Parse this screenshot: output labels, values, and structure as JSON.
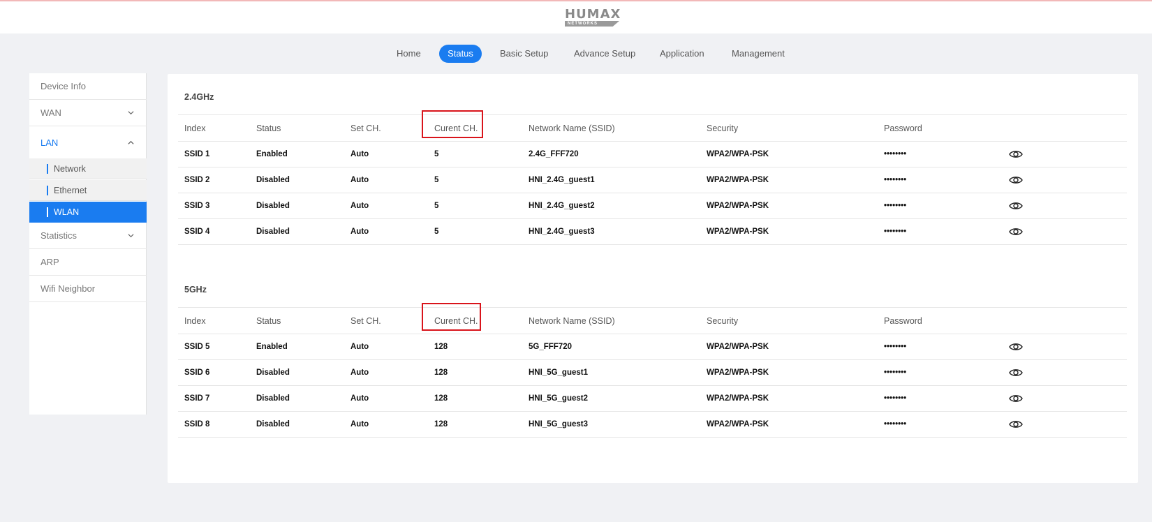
{
  "brand": {
    "logo_text": "HUMAX",
    "logo_sub": "NETWORKS"
  },
  "nav": {
    "items": [
      "Home",
      "Status",
      "Basic Setup",
      "Advance Setup",
      "Application",
      "Management"
    ],
    "active": "Status"
  },
  "sidebar": {
    "items": [
      {
        "label": "Device Info"
      },
      {
        "label": "WAN",
        "chevron": "chevron-down-icon"
      },
      {
        "label": "LAN",
        "chevron": "chevron-up-icon"
      },
      {
        "label": "Statistics",
        "chevron": "chevron-down-icon"
      },
      {
        "label": "ARP"
      },
      {
        "label": "Wifi Neighbor"
      }
    ],
    "lan_sub": [
      "Network",
      "Ethernet",
      "WLAN"
    ],
    "active_sub": "WLAN"
  },
  "columns": [
    "Index",
    "Status",
    "Set CH.",
    "Curent CH.",
    "Network Name (SSID)",
    "Security",
    "Password"
  ],
  "bands": [
    {
      "title": "2.4GHz",
      "rows": [
        {
          "index": "SSID 1",
          "status": "Enabled",
          "set_ch": "Auto",
          "cur_ch": "5",
          "ssid": "2.4G_FFF720",
          "security": "WPA2/WPA-PSK",
          "password": "••••••••"
        },
        {
          "index": "SSID 2",
          "status": "Disabled",
          "set_ch": "Auto",
          "cur_ch": "5",
          "ssid": "HNI_2.4G_guest1",
          "security": "WPA2/WPA-PSK",
          "password": "••••••••"
        },
        {
          "index": "SSID 3",
          "status": "Disabled",
          "set_ch": "Auto",
          "cur_ch": "5",
          "ssid": "HNI_2.4G_guest2",
          "security": "WPA2/WPA-PSK",
          "password": "••••••••"
        },
        {
          "index": "SSID 4",
          "status": "Disabled",
          "set_ch": "Auto",
          "cur_ch": "5",
          "ssid": "HNI_2.4G_guest3",
          "security": "WPA2/WPA-PSK",
          "password": "••••••••"
        }
      ]
    },
    {
      "title": "5GHz",
      "rows": [
        {
          "index": "SSID 5",
          "status": "Enabled",
          "set_ch": "Auto",
          "cur_ch": "128",
          "ssid": "5G_FFF720",
          "security": "WPA2/WPA-PSK",
          "password": "••••••••"
        },
        {
          "index": "SSID 6",
          "status": "Disabled",
          "set_ch": "Auto",
          "cur_ch": "128",
          "ssid": "HNI_5G_guest1",
          "security": "WPA2/WPA-PSK",
          "password": "••••••••"
        },
        {
          "index": "SSID 7",
          "status": "Disabled",
          "set_ch": "Auto",
          "cur_ch": "128",
          "ssid": "HNI_5G_guest2",
          "security": "WPA2/WPA-PSK",
          "password": "••••••••"
        },
        {
          "index": "SSID 8",
          "status": "Disabled",
          "set_ch": "Auto",
          "cur_ch": "128",
          "ssid": "HNI_5G_guest3",
          "security": "WPA2/WPA-PSK",
          "password": "••••••••"
        }
      ]
    }
  ],
  "colors": {
    "accent": "#1a7cf0",
    "highlight": "#d9141b",
    "background": "#f0f1f4"
  },
  "icons": {
    "show_password": "eye-icon"
  }
}
